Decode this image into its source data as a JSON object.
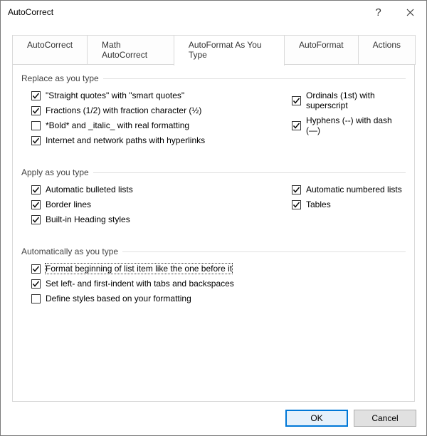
{
  "window": {
    "title": "AutoCorrect"
  },
  "tabs": {
    "t0": "AutoCorrect",
    "t1": "Math AutoCorrect",
    "t2": "AutoFormat As You Type",
    "t3": "AutoFormat",
    "t4": "Actions"
  },
  "groups": {
    "replace": {
      "title": "Replace as you type",
      "smart_quotes": {
        "label": "\"Straight quotes\" with \"smart quotes\"",
        "checked": true
      },
      "fractions": {
        "label": "Fractions (1/2) with fraction character (½)",
        "checked": true
      },
      "bold_italic": {
        "label": "*Bold* and _italic_ with real formatting",
        "checked": false
      },
      "hyperlinks": {
        "label": "Internet and network paths with hyperlinks",
        "checked": true
      },
      "ordinals": {
        "label": "Ordinals (1st) with superscript",
        "checked": true
      },
      "hyphens": {
        "label": "Hyphens (--) with dash (—)",
        "checked": true
      }
    },
    "apply": {
      "title": "Apply as you type",
      "bulleted": {
        "label": "Automatic bulleted lists",
        "checked": true
      },
      "border": {
        "label": "Border lines",
        "checked": true
      },
      "heading": {
        "label": "Built-in Heading styles",
        "checked": true
      },
      "numbered": {
        "label": "Automatic numbered lists",
        "checked": true
      },
      "tables": {
        "label": "Tables",
        "checked": true
      }
    },
    "auto": {
      "title": "Automatically as you type",
      "format_list": {
        "label": "Format beginning of list item like the one before it",
        "checked": true,
        "focused": true
      },
      "indent": {
        "label": "Set left- and first-indent with tabs and backspaces",
        "checked": true
      },
      "styles": {
        "label": "Define styles based on your formatting",
        "checked": false
      }
    }
  },
  "buttons": {
    "ok": "OK",
    "cancel": "Cancel"
  }
}
